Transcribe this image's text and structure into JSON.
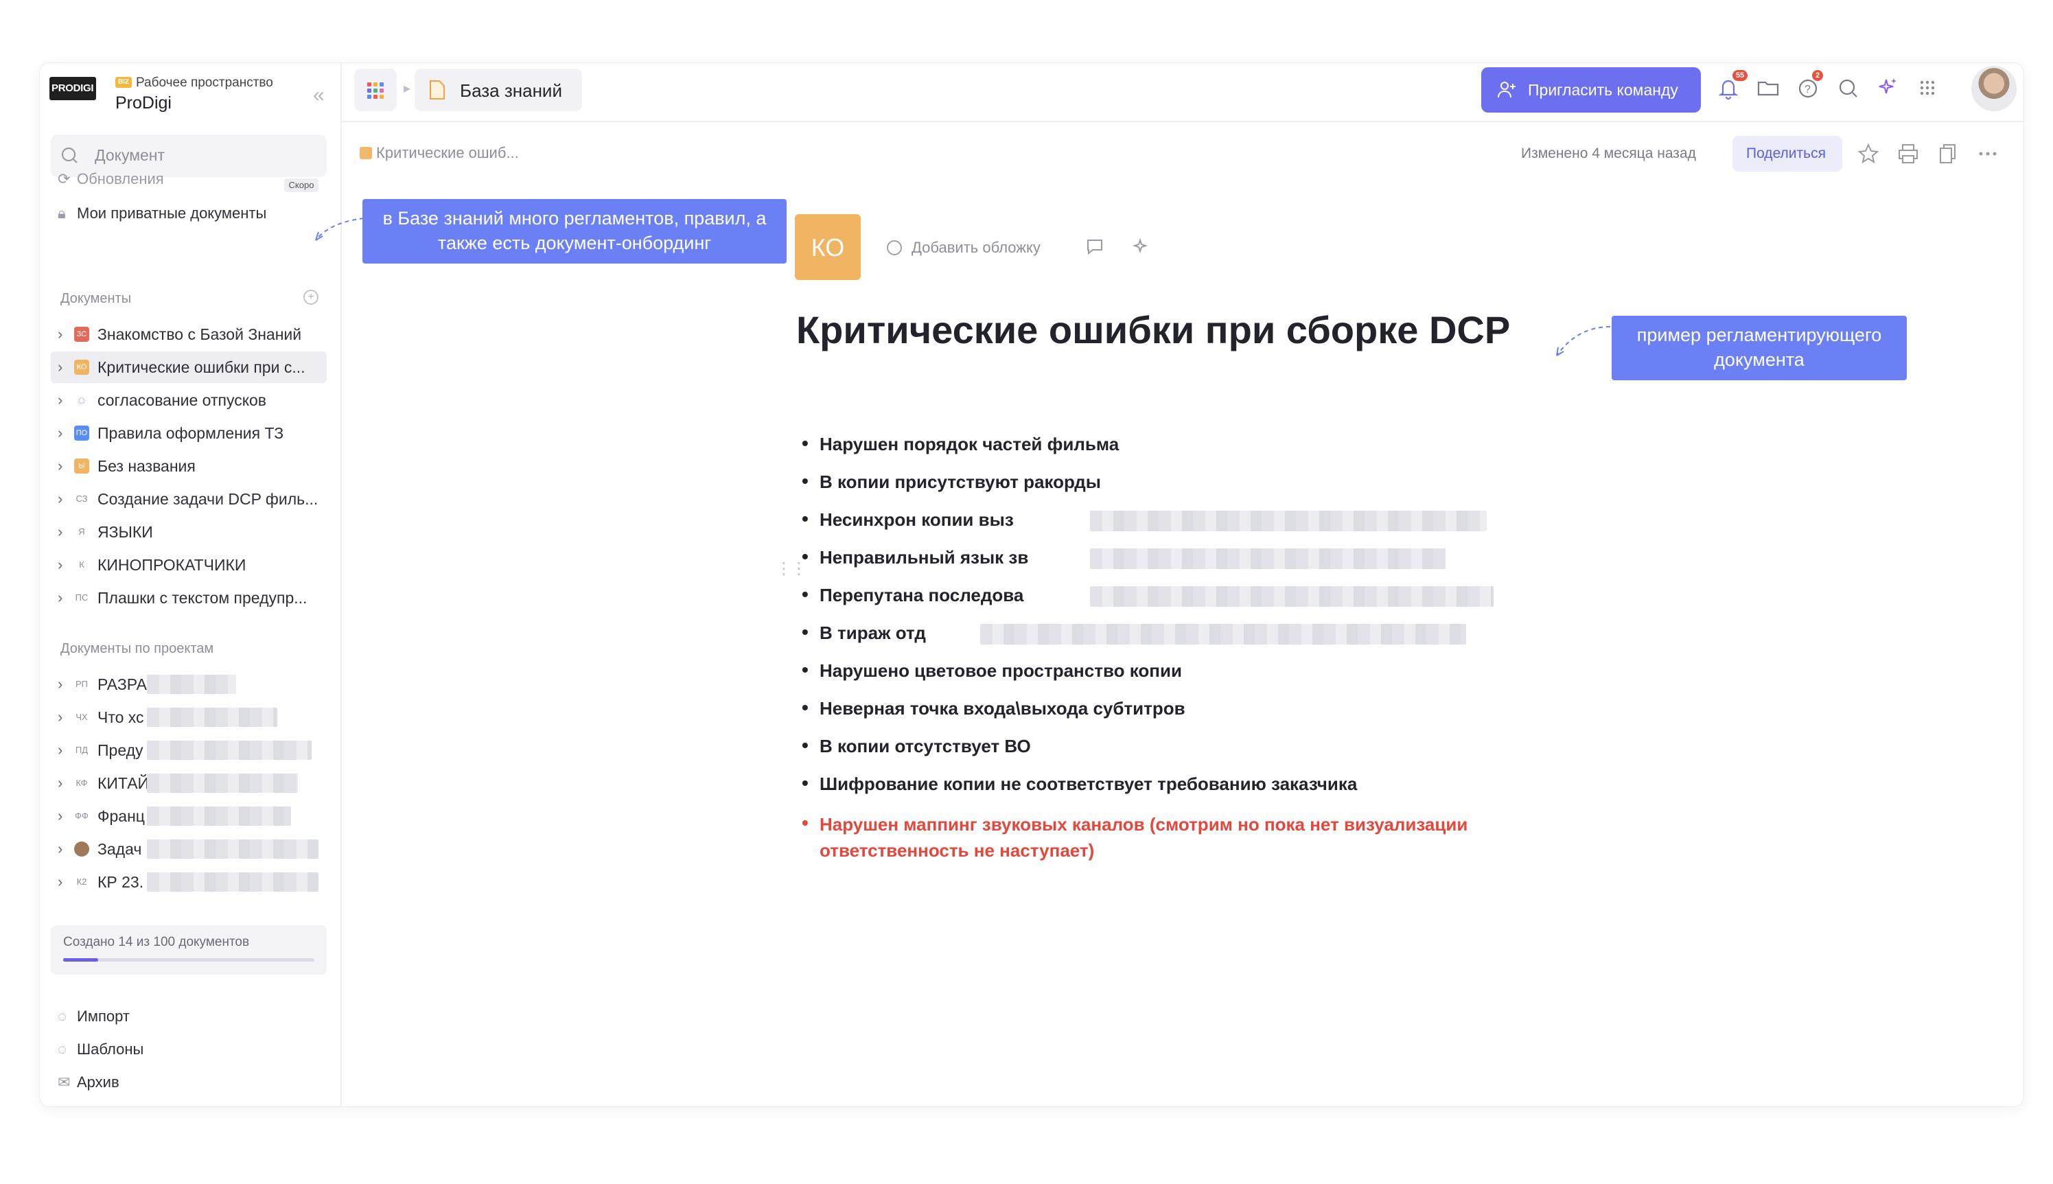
{
  "workspace": {
    "logo": "PRODIGI",
    "badge": "BIZ",
    "subtitle": "Рабочее пространство",
    "name": "ProDigi"
  },
  "sidebar": {
    "search_placeholder": "Документ",
    "updates": "Обновления",
    "soon_badge": "Скоро",
    "private_docs": "Мои приватные документы",
    "docs_title": "Документы",
    "docs": [
      {
        "icon": "ЗС",
        "color": "#e06a5b",
        "label": "Знакомство с Базой Знаний",
        "active": false
      },
      {
        "icon": "КО",
        "color": "#f1b463",
        "label": "Критические ошибки при с...",
        "active": true
      },
      {
        "icon": "bulb",
        "color": "#6b6ff0",
        "label": "согласование отпусков",
        "active": false
      },
      {
        "icon": "ПО",
        "color": "#5b8ef0",
        "label": "Правила оформления ТЗ",
        "active": false
      },
      {
        "icon": "Ы",
        "color": "#f1b463",
        "label": "Без названия",
        "active": false
      },
      {
        "icon": "СЗ",
        "color": "",
        "label": "Создание задачи DCP филь...",
        "active": false
      },
      {
        "icon": "Я",
        "color": "",
        "label": "ЯЗЫКИ",
        "active": false
      },
      {
        "icon": "К",
        "color": "",
        "label": "КИНОПРОКАТЧИКИ",
        "active": false
      },
      {
        "icon": "ПС",
        "color": "",
        "label": "Плашки с текстом предупр...",
        "active": false
      }
    ],
    "projects_title": "Документы по проектам",
    "projects": [
      {
        "icon": "РП",
        "label": "РАЗРА"
      },
      {
        "icon": "ЧХ",
        "label": "Что хс"
      },
      {
        "icon": "ПД",
        "label": "Преду"
      },
      {
        "icon": "КФ",
        "label": "КИТАЙ"
      },
      {
        "icon": "ФФ",
        "label": "Франц"
      },
      {
        "icon": "img",
        "label": "Задач"
      },
      {
        "icon": "К2",
        "label": "КР 23."
      }
    ],
    "quota_text": "Создано 14 из 100 документов",
    "quota_fraction": 0.14,
    "bottom": [
      {
        "icon": "import-icon",
        "label": "Импорт"
      },
      {
        "icon": "templates-icon",
        "label": "Шаблоны"
      },
      {
        "icon": "archive-icon",
        "label": "Архив"
      }
    ]
  },
  "topbar": {
    "section": "База знаний",
    "invite_label": "Пригласить команду",
    "notifications_count": "55",
    "help_count": "2"
  },
  "doc_header": {
    "breadcrumb": "Критические ошиб...",
    "modified": "Изменено 4 месяца назад",
    "share_label": "Поделиться"
  },
  "document": {
    "icon_text": "КО",
    "add_cover": "Добавить обложку",
    "title": "Критические ошибки при сборке DCP",
    "items": [
      {
        "text": "Нарушен порядок частей фильма",
        "red": false
      },
      {
        "text": "В копии присутствуют ракорды",
        "red": false
      },
      {
        "text": "Несинхрон копии выз",
        "red": false
      },
      {
        "text": "Неправильный язык зв",
        "red": false
      },
      {
        "text": "Перепутана последова",
        "red": false
      },
      {
        "text": "В тираж отд",
        "red": false
      },
      {
        "text": "Нарушено цветовое пространство копии",
        "red": false
      },
      {
        "text": "Неверная точка входа\\выхода субтитров",
        "red": false
      },
      {
        "text": "В копии отсутствует ВО",
        "red": false
      },
      {
        "text": "Шифрование копии не соответствует требованию заказчика",
        "red": false
      },
      {
        "text": "Нарушен маппинг звуковых каналов  (смотрим но пока нет визуализации ответственность не наступает)",
        "red": true
      }
    ]
  },
  "annotations": {
    "left": "в Базе знаний много регламентов, правил, а также есть документ-онбординг",
    "right": "пример регламентирующего документа"
  },
  "colors": {
    "accent": "#6b6ff0",
    "annotation": "#6b80f5",
    "danger": "#e4473b"
  }
}
